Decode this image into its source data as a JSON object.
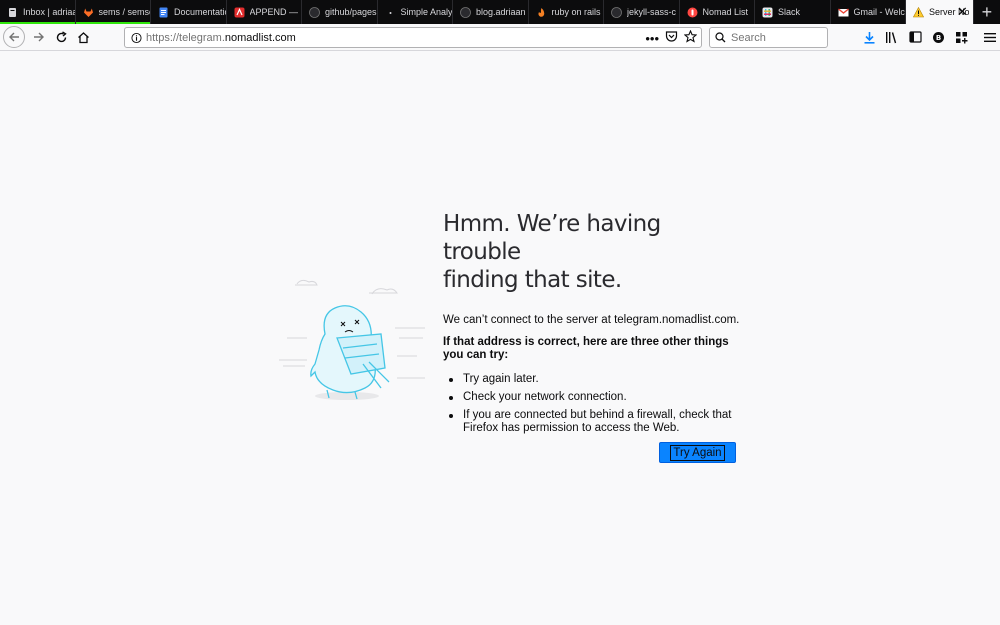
{
  "tabs": [
    {
      "label": "Inbox | adriaa",
      "icon": "envelope-icon",
      "indicator": "#30e60b"
    },
    {
      "label": "sems / semsol",
      "icon": "gitlab-icon",
      "indicator": "#30e60b"
    },
    {
      "label": "Documentation",
      "icon": "document-icon",
      "indicator": ""
    },
    {
      "label": "APPEND — Re",
      "icon": "append-icon",
      "indicator": ""
    },
    {
      "label": "github/pages",
      "icon": "github-icon",
      "indicator": ""
    },
    {
      "label": "Simple Analytics",
      "icon": "dot-icon",
      "indicator": ""
    },
    {
      "label": "blog.adriaan",
      "icon": "github-icon",
      "indicator": ""
    },
    {
      "label": "ruby on rails",
      "icon": "flame-icon",
      "indicator": ""
    },
    {
      "label": "jekyll-sass-c",
      "icon": "github-icon",
      "indicator": ""
    },
    {
      "label": "Nomad List",
      "icon": "nomad-icon",
      "indicator": ""
    },
    {
      "label": "Slack",
      "icon": "slack-icon",
      "indicator": ""
    },
    {
      "label": "Gmail - Welc",
      "icon": "gmail-icon",
      "indicator": ""
    }
  ],
  "selected_tab": {
    "label": "Server Not Found",
    "icon": "warning-icon"
  },
  "navbar": {
    "url_prefix": "https://telegram.",
    "url_domain": "nomadlist.com",
    "search_placeholder": "Search"
  },
  "error": {
    "title_line1": "Hmm. We’re having trouble",
    "title_line2": "finding that site.",
    "description": "We can’t connect to the server at telegram.nomadlist.com.",
    "hint": "If that address is correct, here are three other things you can try:",
    "items": [
      "Try again later.",
      "Check your network connection.",
      "If you are connected but behind a firewall, check that Firefox has permission to access the Web."
    ],
    "button_label": "Try Again"
  },
  "colors": {
    "accent": "#0a84ff",
    "tabstrip": "#0c0c0d",
    "illustration": "#45c6e6"
  }
}
